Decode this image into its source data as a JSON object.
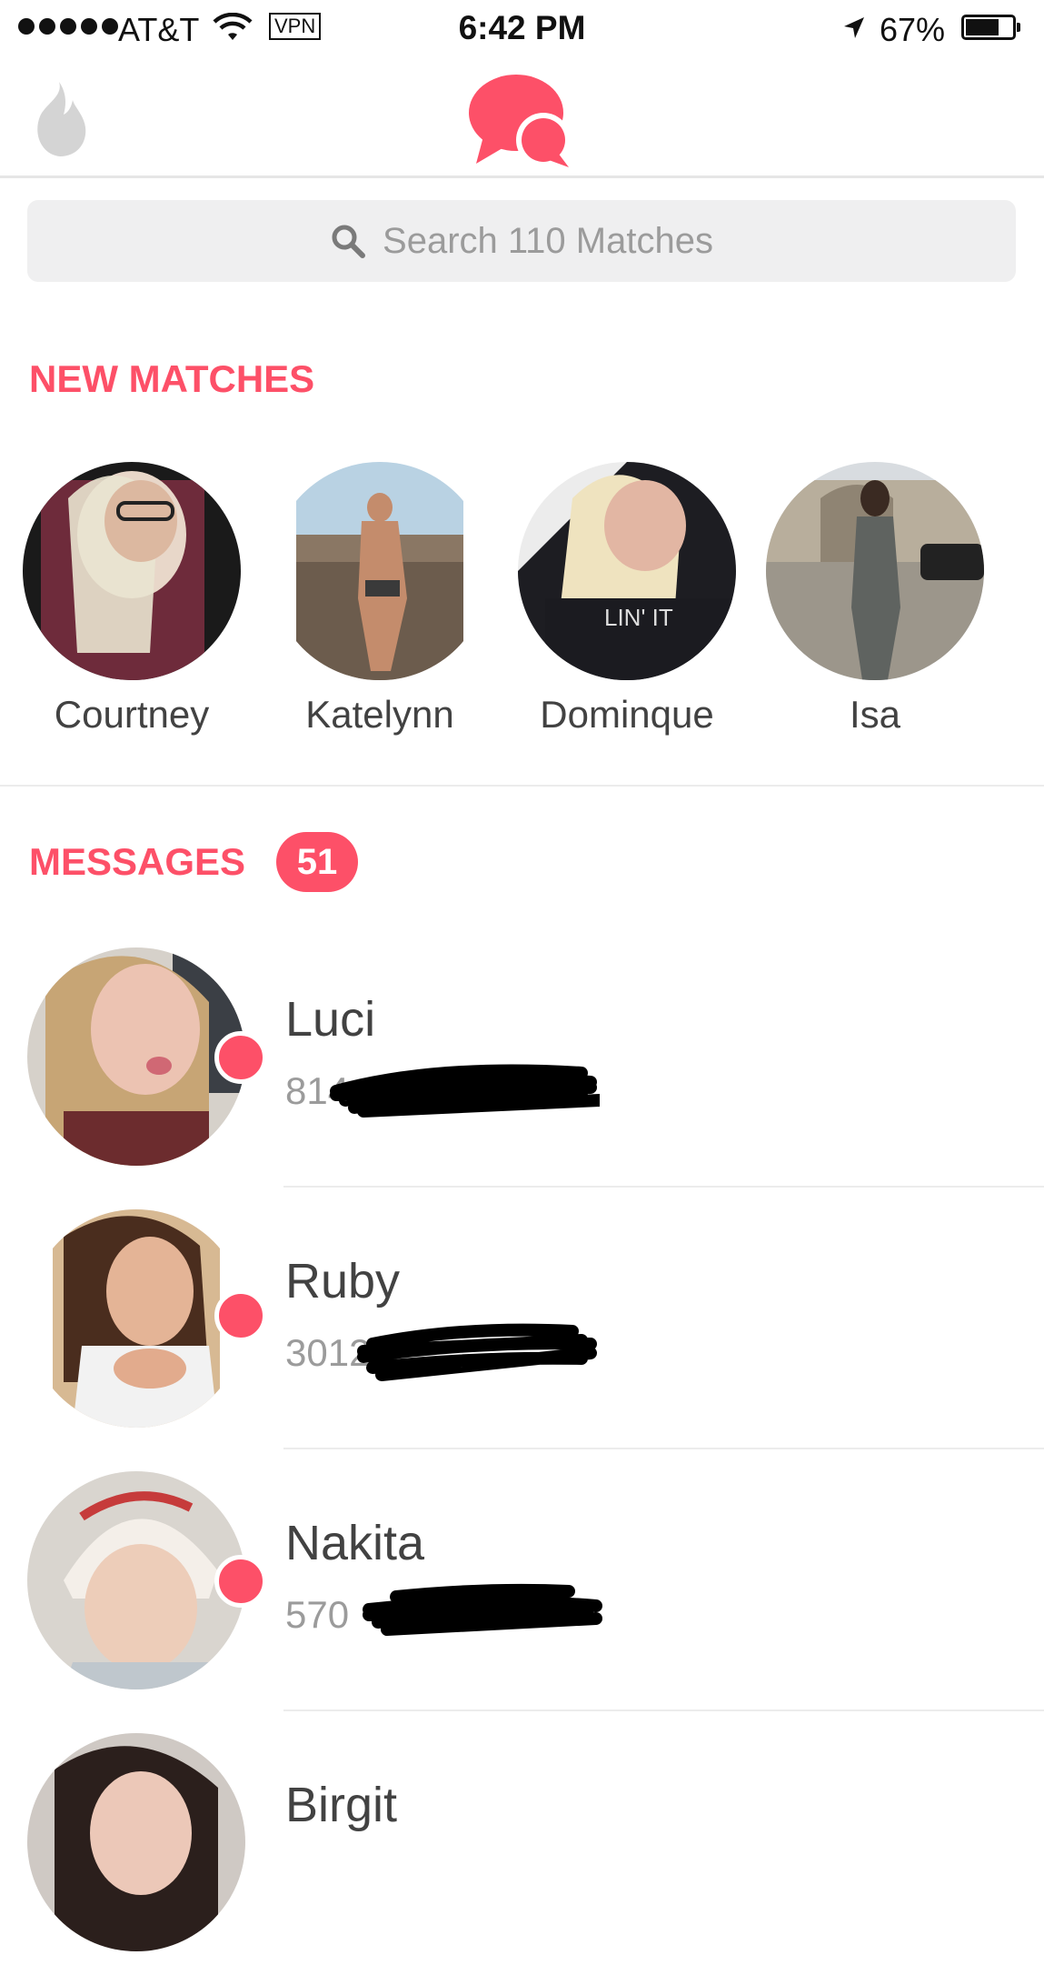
{
  "status_bar": {
    "carrier": "AT&T",
    "vpn": "VPN",
    "time": "6:42 PM",
    "battery": "67%",
    "battery_level": 0.67
  },
  "nav": {
    "left_icon": "flame-icon",
    "center_icon": "chat-bubbles-icon"
  },
  "search": {
    "placeholder": "Search 110 Matches"
  },
  "new_matches": {
    "title": "NEW MATCHES",
    "items": [
      {
        "name": "Courtney"
      },
      {
        "name": "Katelynn"
      },
      {
        "name": "Dominque"
      },
      {
        "name": "Isa"
      }
    ]
  },
  "messages": {
    "title": "MESSAGES",
    "count": "51",
    "items": [
      {
        "name": "Luci",
        "preview": "814",
        "unread": true
      },
      {
        "name": "Ruby",
        "preview": "3012",
        "unread": true
      },
      {
        "name": "Nakita",
        "preview": "570",
        "unread": true
      },
      {
        "name": "Birgit",
        "preview": "",
        "unread": false
      }
    ]
  },
  "colors": {
    "accent": "#fd5068",
    "text": "#424242",
    "muted": "#9b9b9b",
    "search_bg": "#efeff0"
  }
}
